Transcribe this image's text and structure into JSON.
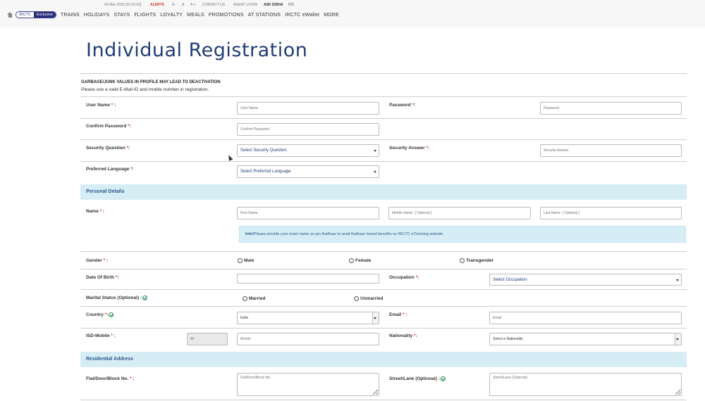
{
  "top": {
    "datetime": "06-Mar-2025 [10:16:22]",
    "alerts": "ALERTS",
    "font_a_minus": "A -",
    "font_a": "A",
    "font_a_plus": "A +",
    "contact": "CONTACT US",
    "agent": "AGENT LOGIN",
    "ask": "ASK DISHA",
    "hindi": "हिंदी"
  },
  "nav": {
    "irctc": "IRCTC",
    "exclusive": "Exclusive",
    "items": [
      "TRAINS",
      "HOLIDAYS",
      "STAYS",
      "FLIGHTS",
      "LOYALTY",
      "MEALS",
      "PROMOTIONS",
      "AT STATIONS",
      "IRCTC eWallet",
      "MORE"
    ]
  },
  "page_title": "Individual Registration",
  "warning": "GARBAGE/JUNK VALUES IN PROFILE MAY LEAD TO DEACTIVATION",
  "note": "Please use a valid E-Mail ID and mobile number in registration.",
  "form": {
    "username_label": "User Name",
    "username_ph": "User Name",
    "password_label": "Password",
    "password_ph": "Password",
    "confirm_label": "Confirm Password",
    "confirm_ph": "Confirm Password",
    "secq_label": "Security Question",
    "secq_value": "Select Security Question",
    "seca_label": "Security Answer",
    "seca_ph": "Security Answer",
    "lang_label": "Preferred Language",
    "lang_value": "Select Preferred Language",
    "req_mark": "*",
    "colon": ":"
  },
  "personal": {
    "section": "Personal Details",
    "name_label": "Name",
    "first_ph": "First Name",
    "middle_ph": "Middle Name  [ Optional ]",
    "last_ph": "Last Name  [ Optional ]",
    "info_bold": "Info!",
    "info_text": "Please provide your exact name as per Aadhaar to avail Aadhaar based benefits on IRCTC eTicketing website.",
    "gender_label": "Gender",
    "gender_options": [
      "Male",
      "Female",
      "Transgender"
    ],
    "dob_label": "Date Of Birth",
    "occupation_label": "Occupation",
    "occupation_value": "Select Occupation",
    "marital_label": "Marital Status (Optional) :",
    "marital_options": [
      "Married",
      "Unmarried"
    ],
    "country_label": "Country",
    "country_value": "India",
    "email_label": "Email",
    "email_ph": "Email",
    "isd_label": "ISD-Mobile",
    "isd_value": "91",
    "mobile_ph": "Mobile",
    "nationality_label": "Nationality",
    "nationality_value": "Select a Nationality"
  },
  "address": {
    "section": "Residential Address",
    "flat_label": "Flat/Door/Block No.",
    "flat_ph": "Flat/Door/Block No.",
    "street_label": "Street/Lane (Optional) :",
    "street_ph": "Street/Lane (Optional)"
  },
  "colors": {
    "title": "#213d77",
    "section_bg": "#d7edf6",
    "required": "#d32f2f"
  }
}
